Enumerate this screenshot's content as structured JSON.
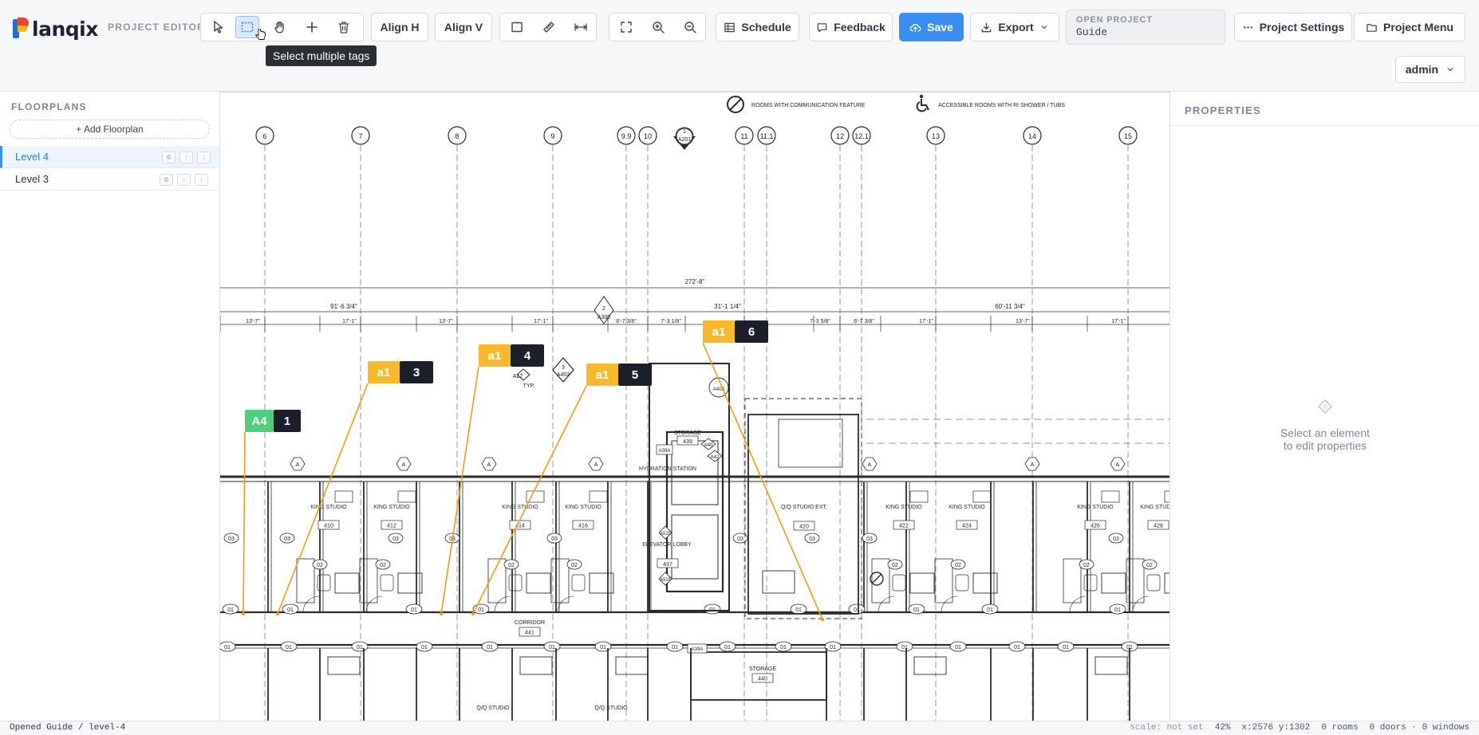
{
  "app": {
    "logo_text": "lanqix",
    "logo_letter": "P",
    "editor_label": "PROJECT EDITOR",
    "colors": {
      "accent": "#3a8ef0",
      "tag_yellow": "#f6b92a",
      "tag_green": "#4fcf7d",
      "tag_dark": "#1b1f2b",
      "leader": "#f39c12"
    }
  },
  "toolbar": {
    "tools": [
      {
        "name": "select",
        "icon": "cursor-icon"
      },
      {
        "name": "multi-select",
        "icon": "marquee-select-icon",
        "active": true
      },
      {
        "name": "pan",
        "icon": "hand-icon"
      },
      {
        "name": "add",
        "icon": "plus-icon"
      },
      {
        "name": "delete",
        "icon": "trash-icon"
      }
    ],
    "align_h": "Align H",
    "align_v": "Align V",
    "shape_tools": [
      "rectangle-icon",
      "measure-icon",
      "dimension-icon"
    ],
    "view_tools": [
      "fit-icon",
      "zoom-in-icon",
      "zoom-out-icon"
    ],
    "schedule": "Schedule",
    "feedback": "Feedback",
    "save": "Save",
    "export": "Export",
    "open_project_label": "OPEN PROJECT",
    "open_project_value": "Guide",
    "project_settings": "Project Settings",
    "project_menu": "Project Menu",
    "user": "admin",
    "tooltip": "Select multiple tags"
  },
  "sidebar": {
    "title": "FLOORPLANS",
    "add_label": "+ Add Floorplan",
    "floors": [
      {
        "label": "Level 4",
        "selected": true
      },
      {
        "label": "Level 3",
        "selected": false
      }
    ],
    "row_actions": [
      "gear-icon",
      "arrow-up-icon",
      "arrow-down-icon"
    ]
  },
  "properties": {
    "title": "PROPERTIES",
    "empty_line1": "Select an element",
    "empty_line2": "to edit properties"
  },
  "plan": {
    "legend_communication": "ROOMS WITH COMMUNICATION FEATURE",
    "legend_accessible": "ACCESSIBLE ROOMS WITH RI SHOWER / TUBS",
    "grid_labels": [
      "6",
      "7",
      "8",
      "9",
      "9.9",
      "10",
      "11",
      "11.1",
      "12",
      "12.1",
      "13",
      "14",
      "15"
    ],
    "overall_dim": "272'-8\"",
    "dim_left": "91'-6 3/4\"",
    "dim_mid": "31'-1 1/4\"",
    "dim_right": "60'-11 3/4\"",
    "bay_dims": [
      "13'-7\"",
      "17'-1\"",
      "13'-7\"",
      "17'-1\"",
      "6'-7 3/8\"",
      "7'-3 1/8\"",
      "7'-3 5/8\"",
      "6'-7 3/8\"",
      "17'-1\"",
      "13'-7\"",
      "17'-1\""
    ],
    "room_name": "KING STUDIO",
    "rooms": [
      "410",
      "412",
      "414",
      "416",
      "422",
      "424",
      "426",
      "428"
    ],
    "qq_room": {
      "name": "Q/Q STUDIO EXT.",
      "number": "420"
    },
    "storage_upper": {
      "name": "STORAGE",
      "number": "439"
    },
    "hydration": "HYDRATION STATION",
    "elevator": {
      "name": "ELEVATOR LOBBY",
      "number": "437"
    },
    "corridor": {
      "name": "CORRIDOR",
      "number": "441"
    },
    "storage_lower": {
      "name": "STORAGE",
      "number": "440"
    },
    "lower_labels": [
      "Q/Q STUDIO",
      "Q/Q STUDIO"
    ],
    "typ": "TYP.",
    "door_tag": "01",
    "window_tags": [
      "02",
      "03"
    ],
    "section_marks": [
      {
        "num": "1",
        "sheet": "A201"
      },
      {
        "num": "2",
        "sheet": "A300"
      },
      {
        "num": "3",
        "sheet": "A402"
      }
    ],
    "callouts": [
      "A22",
      "A40",
      "A42",
      "A41",
      "A515",
      "A39A",
      "A40A",
      "A"
    ]
  },
  "tags": [
    {
      "code": "A4",
      "number": "1",
      "color": "green"
    },
    {
      "code": "a1",
      "number": "3",
      "color": "yellow"
    },
    {
      "code": "a1",
      "number": "4",
      "color": "yellow"
    },
    {
      "code": "a1",
      "number": "5",
      "color": "yellow"
    },
    {
      "code": "a1",
      "number": "6",
      "color": "yellow"
    }
  ],
  "status": {
    "message": "Opened Guide / level-4",
    "scale": "scale: not set",
    "zoom": "42%",
    "coords": "x:2576 y:1302",
    "rooms": "0 rooms",
    "doors_windows": "0 doors · 0 windows"
  }
}
